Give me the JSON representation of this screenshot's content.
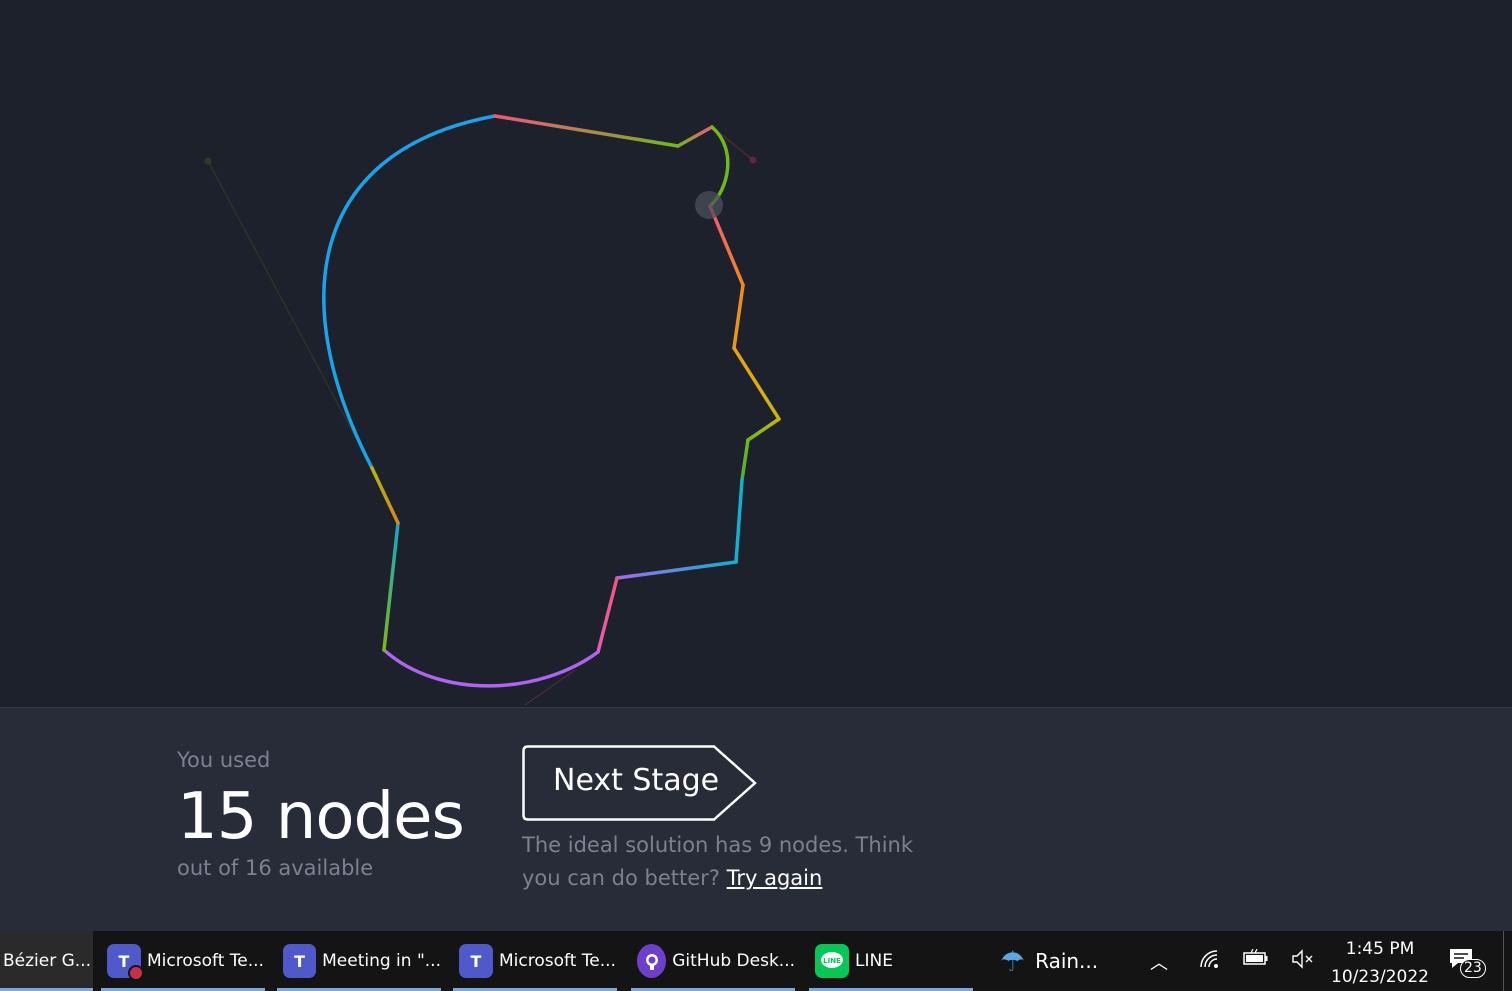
{
  "result": {
    "used_label": "You used",
    "node_count": "15 nodes",
    "available": "out of 16 available",
    "next_stage": "Next Stage",
    "hint_text": "The ideal solution has 9 nodes. Think you can do better?",
    "try_again": "Try again"
  },
  "taskbar": {
    "items": [
      {
        "label": "Bézier G...",
        "icon": "bezier-game-icon"
      },
      {
        "label": "Microsoft Te...",
        "icon": "teams-icon"
      },
      {
        "label": "Meeting in \"...",
        "icon": "teams-icon"
      },
      {
        "label": "Microsoft Te...",
        "icon": "teams-icon"
      },
      {
        "label": "GitHub Desk...",
        "icon": "github-icon"
      },
      {
        "label": "LINE",
        "icon": "line-icon"
      }
    ],
    "weather": "Rain...",
    "time": "1:45 PM",
    "date": "10/23/2022",
    "notifications": "23"
  },
  "colors": {
    "background": "#1d212c",
    "panel": "#272c38",
    "blue": "#1aa3e8",
    "pink": "#f2557d",
    "green": "#6fb81a",
    "orange": "#f08a1c",
    "yellow": "#d6b20f",
    "cyan": "#12b0d0",
    "purple": "#b062f0",
    "taskbar": "#141414"
  }
}
